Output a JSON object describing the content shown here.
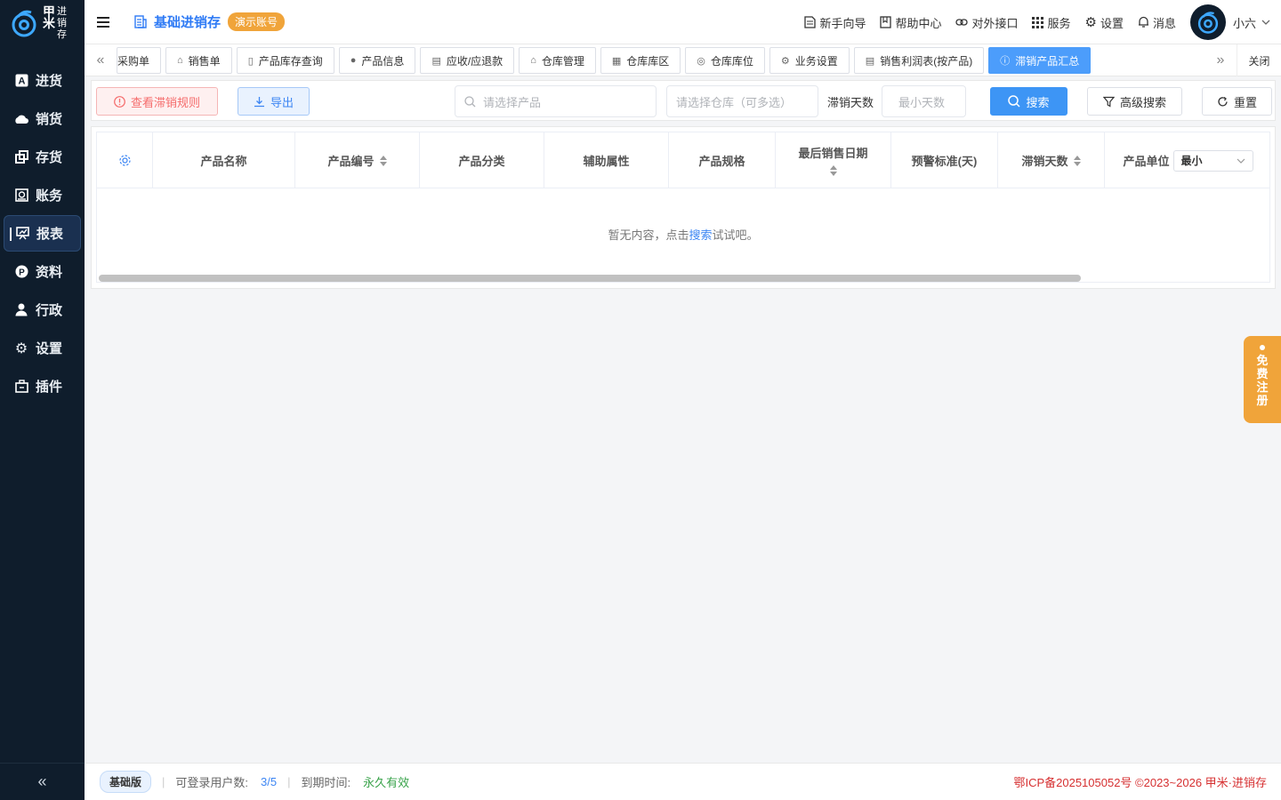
{
  "brand": {
    "line1_a": "甲",
    "line1_b": "进",
    "line2_a": "米",
    "line2_b": "销",
    "line3_b": "存"
  },
  "sidebar": {
    "items": [
      {
        "label": "进货",
        "icon": "purchase-icon"
      },
      {
        "label": "销货",
        "icon": "sales-icon"
      },
      {
        "label": "存货",
        "icon": "inventory-icon"
      },
      {
        "label": "账务",
        "icon": "finance-icon"
      },
      {
        "label": "报表",
        "icon": "report-icon",
        "active": true
      },
      {
        "label": "资料",
        "icon": "data-icon"
      },
      {
        "label": "行政",
        "icon": "admin-icon"
      },
      {
        "label": "设置",
        "icon": "settings-icon"
      },
      {
        "label": "插件",
        "icon": "plugin-icon"
      }
    ],
    "collapse": "«"
  },
  "header": {
    "app_title": "基础进销存",
    "demo_badge": "演示账号",
    "links": {
      "guide": "新手向导",
      "help": "帮助中心",
      "api": "对外接口",
      "service": "服务",
      "settings": "设置",
      "messages": "消息"
    },
    "user": "小六"
  },
  "tabs": {
    "items": [
      {
        "label": "采购单",
        "icon": ""
      },
      {
        "label": "销售单",
        "icon": "⌂"
      },
      {
        "label": "产品库存查询",
        "icon": "▯"
      },
      {
        "label": "产品信息",
        "icon": "●"
      },
      {
        "label": "应收/应退款",
        "icon": "▤"
      },
      {
        "label": "仓库管理",
        "icon": "⌂"
      },
      {
        "label": "仓库库区",
        "icon": "▦"
      },
      {
        "label": "仓库库位",
        "icon": "◎"
      },
      {
        "label": "业务设置",
        "icon": "⚙"
      },
      {
        "label": "销售利润表(按产品)",
        "icon": "▤"
      },
      {
        "label": "滞销产品汇总",
        "icon": "ⓘ",
        "active": true
      }
    ],
    "prev": "«",
    "next": "»",
    "close": "关闭"
  },
  "toolbar": {
    "rule_button": "查看滞销规则",
    "export_button": "导出",
    "product_placeholder": "请选择产品",
    "warehouse_placeholder": "请选择仓库（可多选）",
    "days_label": "滞销天数",
    "min_days_placeholder": "最小天数",
    "search_button": "搜索",
    "advanced_button": "高级搜索",
    "reset_button": "重置"
  },
  "table": {
    "columns": {
      "name": "产品名称",
      "code": "产品编号",
      "category": "产品分类",
      "attr": "辅助属性",
      "spec": "产品规格",
      "last_sale": "最后销售日期",
      "warn": "预警标准(天)",
      "days": "滞销天数",
      "unit": "产品单位"
    },
    "unit_select": "最小",
    "empty_prefix": "暂无内容，点击",
    "empty_link": "搜索",
    "empty_suffix": "试试吧。"
  },
  "register_tab": {
    "c1": "免",
    "c2": "费",
    "c3": "注",
    "c4": "册"
  },
  "footer": {
    "plan": "基础版",
    "users_label": "可登录用户数:",
    "users_value": "3/5",
    "expire_label": "到期时间:",
    "expire_value": "永久有效",
    "icp": "鄂ICP备2025105052号 ©2023~2026 甲米·进销存"
  },
  "colors": {
    "sidebar": "#0f1d2c",
    "accent": "#3d95f5",
    "badge": "#f0a43a",
    "danger": "#f56c6c"
  }
}
